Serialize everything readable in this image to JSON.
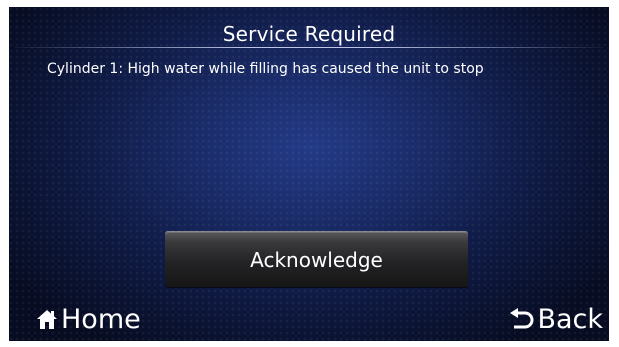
{
  "screen": {
    "title": "Service Required",
    "message": "Cylinder 1: High water while filling has caused the unit to stop"
  },
  "buttons": {
    "acknowledge_label": "Acknowledge"
  },
  "nav": {
    "home_label": "Home",
    "home_icon": "home-icon",
    "back_label": "Back",
    "back_icon": "back-arrow-icon"
  },
  "colors": {
    "background": "#1a2c6a",
    "text": "#ffffff",
    "button": "#232325"
  }
}
